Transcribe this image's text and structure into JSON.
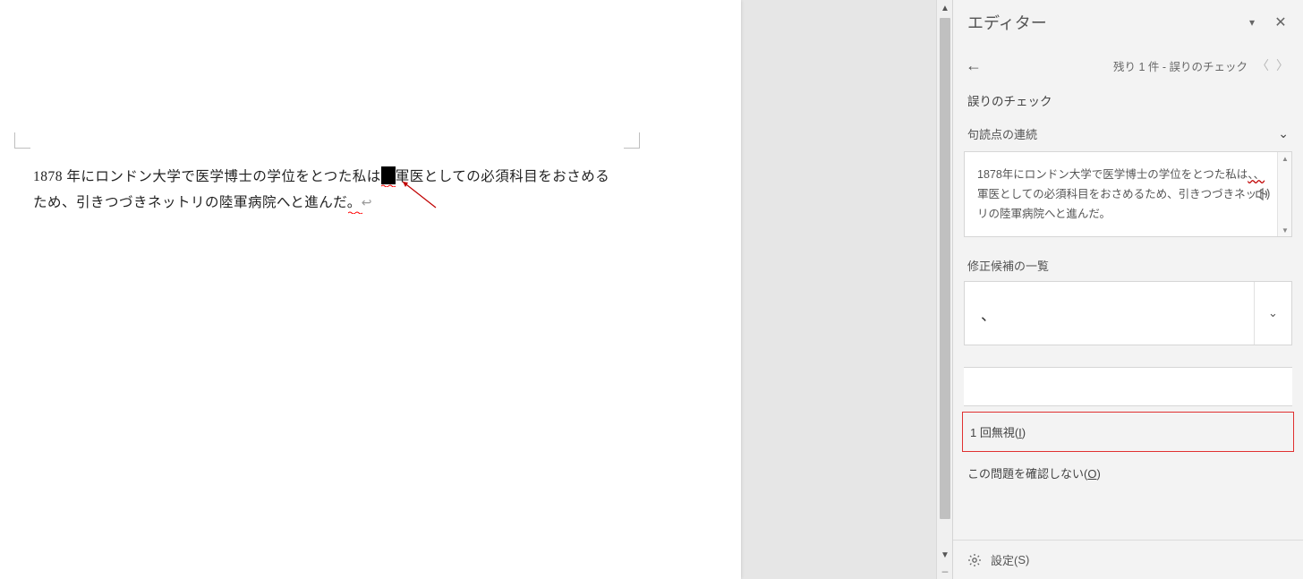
{
  "document": {
    "line1_before": "1878 年にロンドン大学で医学博士の学位をとつた私は",
    "line1_after": "軍医としての必須科目をおさめる",
    "line2": "ため、引きつづきネットリの陸軍病院へと進んだ。"
  },
  "editor": {
    "title": "エディター",
    "nav_text": "残り 1 件 - 誤りのチェック",
    "section_title": "誤りのチェック",
    "rule_label": "句読点の連続",
    "context_pre": "1878年にロンドン大学で医学博士の学位をとつた私は",
    "context_err": "、、",
    "context_post": "軍医としての必須科目をおさめるため、引きつづきネットリの陸軍病院へと進んだ。",
    "suggestions_label": "修正候補の一覧",
    "suggestion_value": "、",
    "ignore_once_pre": "1 回無視(",
    "ignore_once_key": "I",
    "ignore_once_post": ")",
    "dont_check_pre": "この問題を確認しない(",
    "dont_check_key": "O",
    "dont_check_post": ")",
    "settings_pre": "設定(",
    "settings_key": "S",
    "settings_post": ")"
  }
}
